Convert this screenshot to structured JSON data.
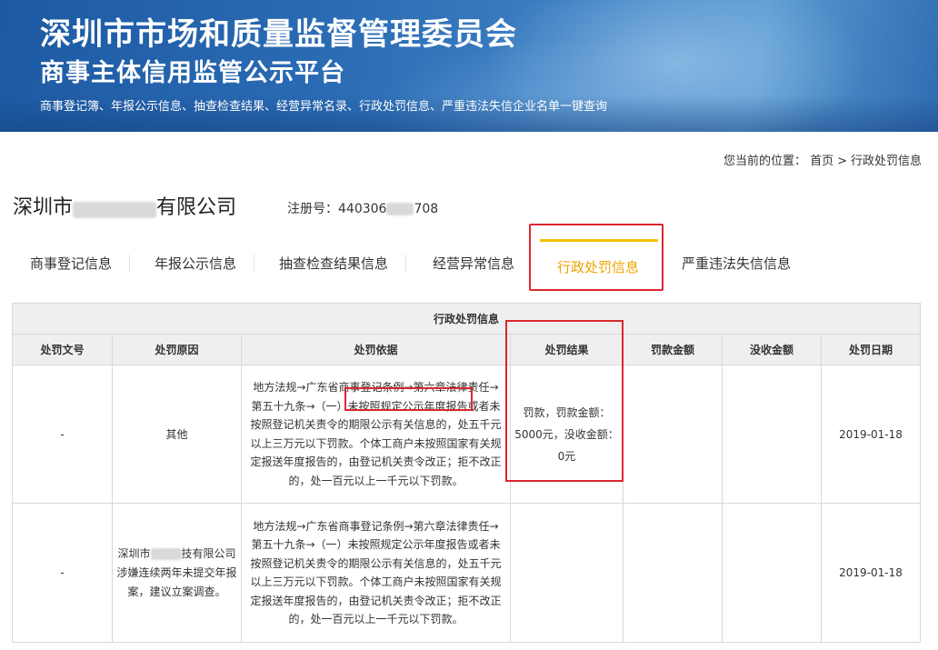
{
  "banner": {
    "title": "深圳市市场和质量监督管理委员会",
    "subtitle": "商事主体信用监管公示平台",
    "links": "商事登记簿、年报公示信息、抽查检查结果、经营异常名录、行政处罚信息、严重违法失信企业名单一键查询"
  },
  "breadcrumb": {
    "label": "您当前的位置：",
    "home": "首页",
    "separator": ">",
    "current": "行政处罚信息"
  },
  "company": {
    "name_prefix": "深圳市",
    "name_suffix": "有限公司",
    "reg_label": "注册号：",
    "reg_prefix": "440306",
    "reg_suffix": "708"
  },
  "tabs": [
    {
      "label": "商事登记信息"
    },
    {
      "label": "年报公示信息"
    },
    {
      "label": "抽查检查结果信息"
    },
    {
      "label": "经营异常信息"
    },
    {
      "label": "行政处罚信息"
    },
    {
      "label": "严重违法失信信息"
    }
  ],
  "active_tab_index": 4,
  "colors": {
    "accent": "#f0a300",
    "highlight": "#d9272e",
    "banner": "#2a6bb4"
  },
  "table": {
    "caption": "行政处罚信息",
    "headers": [
      "处罚文号",
      "处罚原因",
      "处罚依据",
      "处罚结果",
      "罚款金额",
      "没收金额",
      "处罚日期"
    ],
    "rows": [
      {
        "doc_no": "-",
        "reason": "其他",
        "basis_lines": [
          "地方法规→广东省商事登记条例→第六章法律责任→",
          "第五十九条→（一）未按照规定公示年度报告或者未",
          "按照登记机关责令的期限公示有关信息的，处五千元",
          "以上三万元以下罚款。个体工商户未按照国家有关规",
          "定报送年度报告的，由登记机关责令改正；拒不改正",
          "的，处一百元以上一千元以下罚款。"
        ],
        "result_lines": [
          "罚款，罚款金额：",
          "5000元，没收金额：",
          "0元"
        ],
        "fine": "",
        "confiscation": "",
        "date": "2019-01-18"
      },
      {
        "doc_no": "-",
        "reason_lines": [
          "深圳市",
          "技有限公司",
          "涉嫌连续两年未提交年报",
          "案，建议立案调查。"
        ],
        "basis_lines": [
          "地方法规→广东省商事登记条例→第六章法律责任→",
          "第五十九条→（一）未按照规定公示年度报告或者未",
          "按照登记机关责令的期限公示有关信息的，处五千元",
          "以上三万元以下罚款。个体工商户未按照国家有关规",
          "定报送年度报告的，由登记机关责令改正；拒不改正",
          "的，处一百元以上一千元以下罚款。"
        ],
        "result": "",
        "fine": "",
        "confiscation": "",
        "date": "2019-01-18"
      }
    ]
  }
}
